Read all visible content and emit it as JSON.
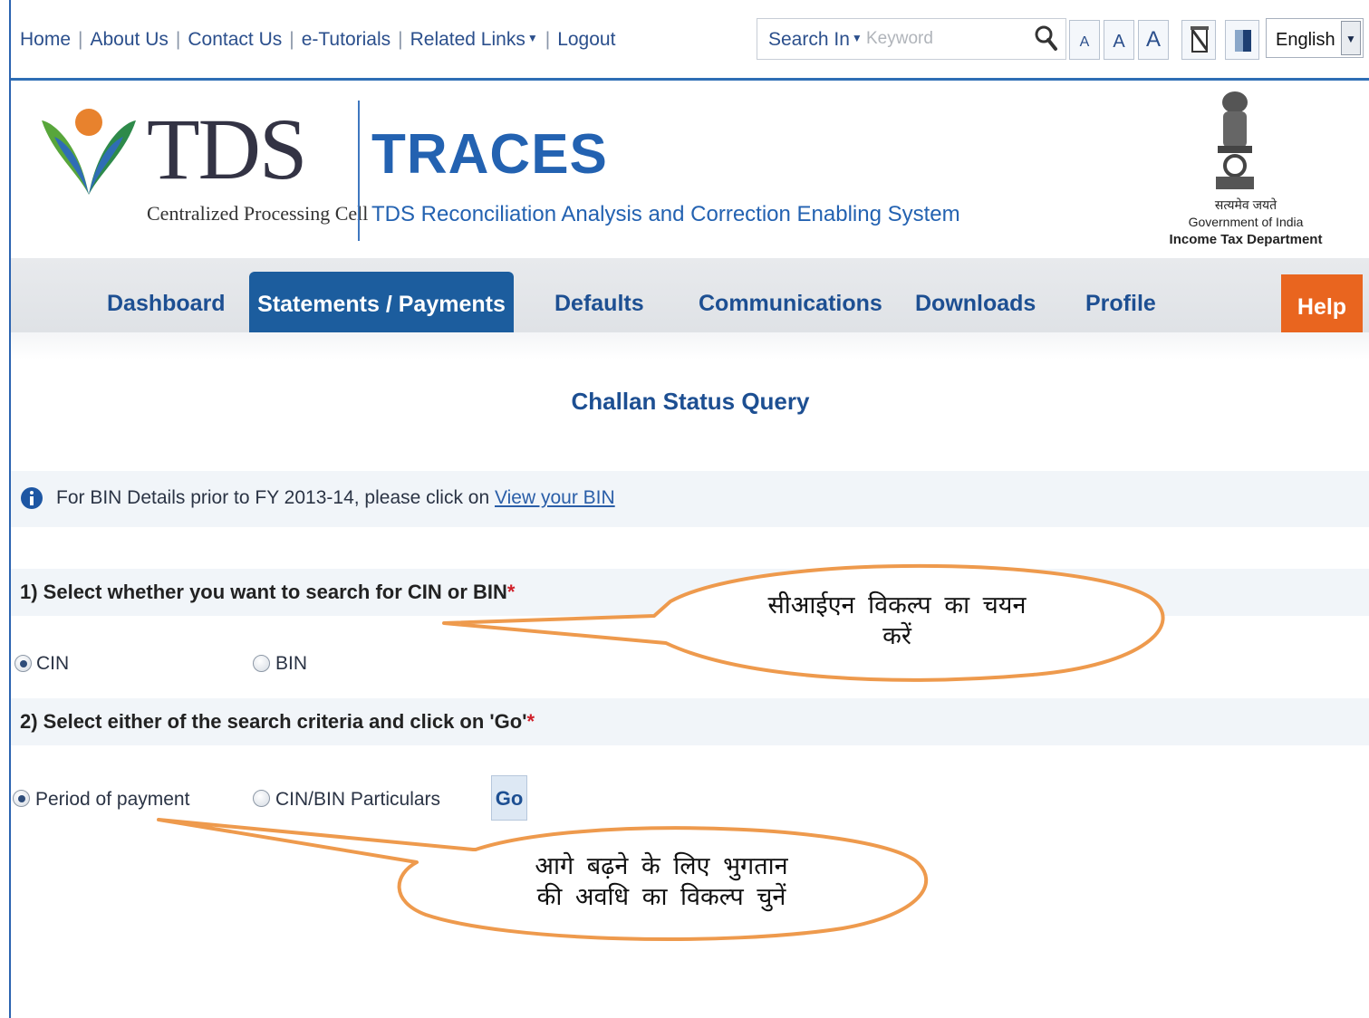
{
  "topbar": {
    "links": {
      "home": "Home",
      "about": "About Us",
      "contact": "Contact Us",
      "tutorials": "e-Tutorials",
      "related": "Related Links",
      "logout": "Logout"
    },
    "search": {
      "label": "Search In",
      "placeholder": "Keyword",
      "icon": "search-icon"
    },
    "font_sizes": [
      "A",
      "A",
      "A"
    ],
    "language": "English"
  },
  "header": {
    "logo_word": "TDS",
    "logo_sub": "Centralized Processing Cell",
    "title": "TRACES",
    "subtitle": "TDS Reconciliation Analysis and Correction Enabling System",
    "emblem_hindi": "सत्यमेव जयते",
    "gov": "Government of India",
    "dept": "Income Tax Department"
  },
  "nav": {
    "items": [
      "Dashboard",
      "Statements / Payments",
      "Defaults",
      "Communications",
      "Downloads",
      "Profile",
      "Help"
    ],
    "active": "Statements / Payments"
  },
  "main": {
    "page_title": "Challan Status Query",
    "info": {
      "text": "For BIN Details prior to FY 2013-14, please click on ",
      "link": "View your BIN"
    },
    "q1": {
      "label": "1) Select whether you want to search for CIN or BIN",
      "required": "*",
      "options": [
        "CIN",
        "BIN"
      ],
      "selected": "CIN"
    },
    "q2": {
      "label": "2) Select either of the search criteria and click on 'Go'",
      "required": "*",
      "options": [
        "Period of payment",
        "CIN/BIN Particulars"
      ],
      "selected": "Period of payment",
      "go_label": "Go"
    }
  },
  "callouts": {
    "first_line1": "सीआईएन विकल्प का चयन",
    "first_line2": "करें",
    "second_line1": "आगे बढ़ने के लिए भुगतान",
    "second_line2": "की अवधि का विकल्प चुनें"
  },
  "colors": {
    "brand_blue": "#2362b1",
    "nav_active": "#1c5d9e",
    "help_orange": "#e9651f",
    "callout_orange": "#ee9a4d"
  }
}
